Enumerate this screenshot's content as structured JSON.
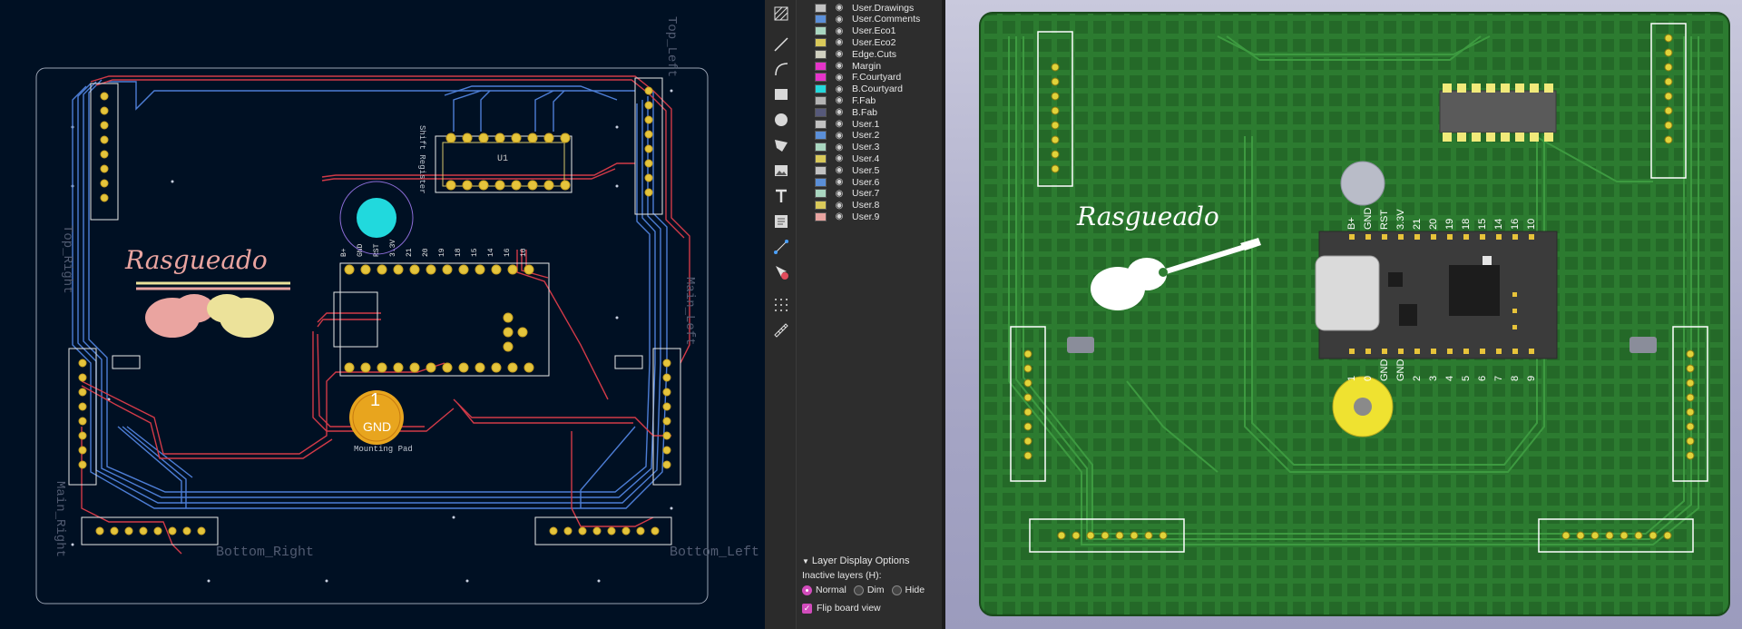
{
  "pcb_editor": {
    "footprint_labels": {
      "top_left": "Top_Left",
      "top_right": "Top_Right",
      "main_left": "Main_Left",
      "main_right": "Main_Right",
      "bottom_right": "Bottom_Right",
      "bottom_left": "Bottom_Left"
    },
    "ic_label": "U1",
    "ic_ref": "Shift Register",
    "mounting_pad": {
      "number": "1",
      "net": "GND",
      "label": "Mounting Pad"
    },
    "logo_text": "Rasgueado",
    "mcu_pin_labels_top": [
      "B+",
      "GND",
      "RST",
      "3.3V",
      "21",
      "20",
      "19",
      "18",
      "15",
      "14",
      "16",
      "10"
    ],
    "mcu_pin_labels_bottom": [
      "1",
      "0",
      "GND",
      "GND",
      "2",
      "3",
      "4",
      "5",
      "6",
      "7",
      "8",
      "9"
    ]
  },
  "toolbar": {
    "tools": [
      "hatch-icon",
      "line-icon",
      "arc-icon",
      "rectangle-icon",
      "circle-icon",
      "polygon-icon",
      "image-icon",
      "text-icon",
      "textbox-icon",
      "dimension-icon",
      "delete-icon",
      "grid-icon",
      "ruler-icon"
    ]
  },
  "layers": [
    {
      "name": "User.Drawings",
      "color": "#c2c2c2"
    },
    {
      "name": "User.Comments",
      "color": "#5b8fd8"
    },
    {
      "name": "User.Eco1",
      "color": "#a9d6c0"
    },
    {
      "name": "User.Eco2",
      "color": "#d9c95a"
    },
    {
      "name": "Edge.Cuts",
      "color": "#d0d0c0"
    },
    {
      "name": "Margin",
      "color": "#e534c9"
    },
    {
      "name": "F.Courtyard",
      "color": "#e534c9"
    },
    {
      "name": "B.Courtyard",
      "color": "#24d8dc"
    },
    {
      "name": "F.Fab",
      "color": "#b4b4b4"
    },
    {
      "name": "B.Fab",
      "color": "#56597a"
    },
    {
      "name": "User.1",
      "color": "#c2c2c2"
    },
    {
      "name": "User.2",
      "color": "#5b8fd8"
    },
    {
      "name": "User.3",
      "color": "#a9d6c0"
    },
    {
      "name": "User.4",
      "color": "#d9c95a"
    },
    {
      "name": "User.5",
      "color": "#c2c2c2"
    },
    {
      "name": "User.6",
      "color": "#5b8fd8"
    },
    {
      "name": "User.7",
      "color": "#a9d6c0"
    },
    {
      "name": "User.8",
      "color": "#d9c95a"
    },
    {
      "name": "User.9",
      "color": "#e8a4a0"
    }
  ],
  "layer_display_options": {
    "title": "Layer Display Options",
    "inactive_label": "Inactive layers (H):",
    "options": [
      "Normal",
      "Dim",
      "Hide"
    ],
    "selected": "Normal",
    "flip_label": "Flip board view",
    "flip_checked": true
  },
  "viewer3d": {
    "logo_text": "Rasgueado"
  }
}
